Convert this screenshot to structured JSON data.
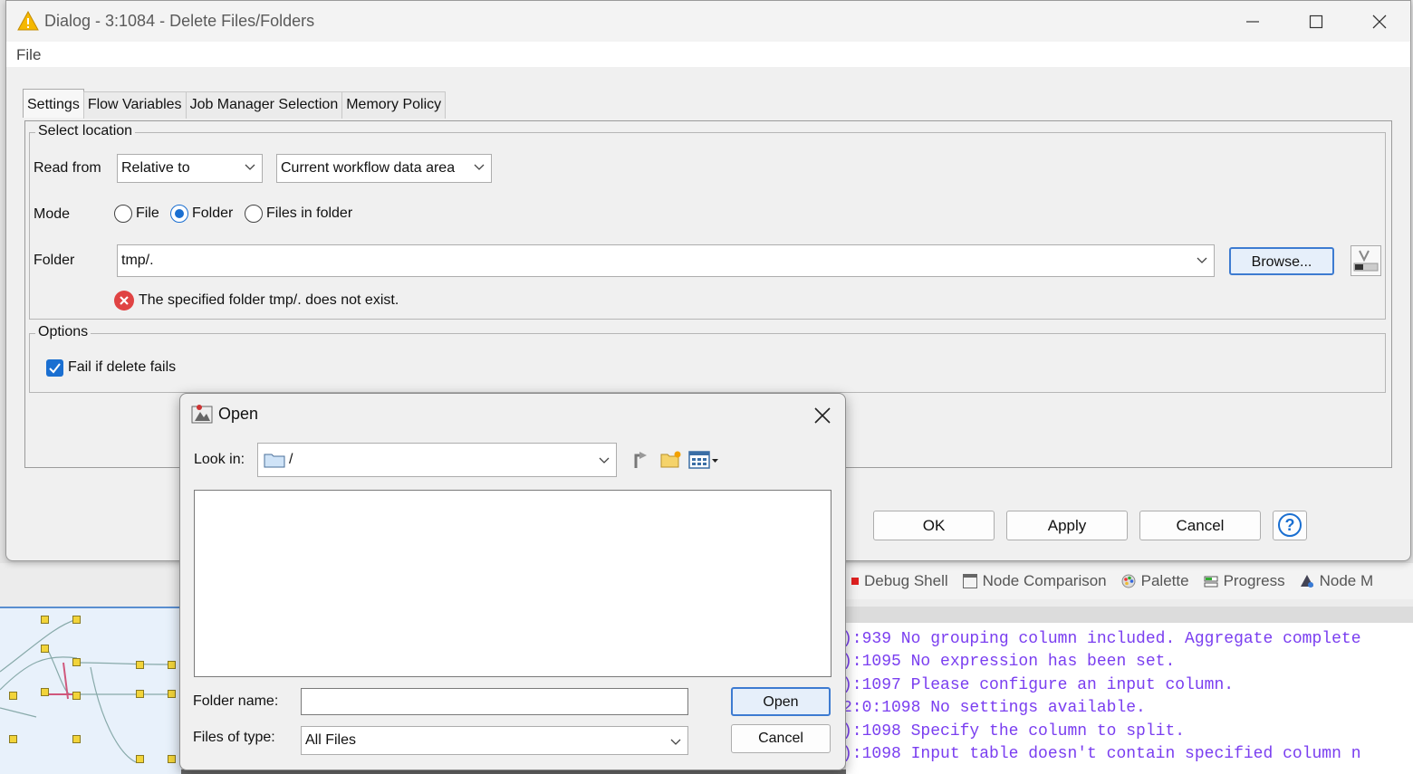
{
  "dialog": {
    "title": "Dialog - 3:1084 - Delete Files/Folders",
    "menu": {
      "file": "File"
    },
    "tabs": [
      "Settings",
      "Flow Variables",
      "Job Manager Selection",
      "Memory Policy"
    ],
    "select_location": {
      "legend": "Select location",
      "read_from_label": "Read from",
      "read_from_value": "Relative to",
      "relative_target_value": "Current workflow data area",
      "mode_label": "Mode",
      "mode_options": [
        "File",
        "Folder",
        "Files in folder"
      ],
      "mode_selected": "Folder",
      "folder_label": "Folder",
      "folder_value": "tmp/.",
      "browse_label": "Browse...",
      "error_message": "The specified folder tmp/. does not exist."
    },
    "options": {
      "legend": "Options",
      "fail_if_delete_fails_label": "Fail if delete fails",
      "fail_if_delete_fails_checked": true
    },
    "buttons": {
      "ok": "OK",
      "apply": "Apply",
      "cancel": "Cancel",
      "help": "?"
    }
  },
  "open_dialog": {
    "title": "Open",
    "look_in_label": "Look in:",
    "look_in_value": "/",
    "folder_name_label": "Folder name:",
    "folder_name_value": "",
    "files_of_type_label": "Files of type:",
    "files_of_type_value": "All Files",
    "open_button": "Open",
    "cancel_button": "Cancel"
  },
  "workbench": {
    "views": [
      "Debug Shell",
      "Node Comparison",
      "Palette",
      "Progress",
      "Node M"
    ],
    "console_lines": [
      "):939 No grouping column included. Aggregate complete",
      "):1095 No expression has been set.",
      "):1097 Please configure an input column.",
      "2:0:1098 No settings available.",
      "):1098 Specify the column to split.",
      "):1098 Input table doesn't contain specified column n"
    ]
  },
  "colors": {
    "accent": "#1a6fd1",
    "error": "#e04343",
    "console_text": "#7a3ef0"
  }
}
